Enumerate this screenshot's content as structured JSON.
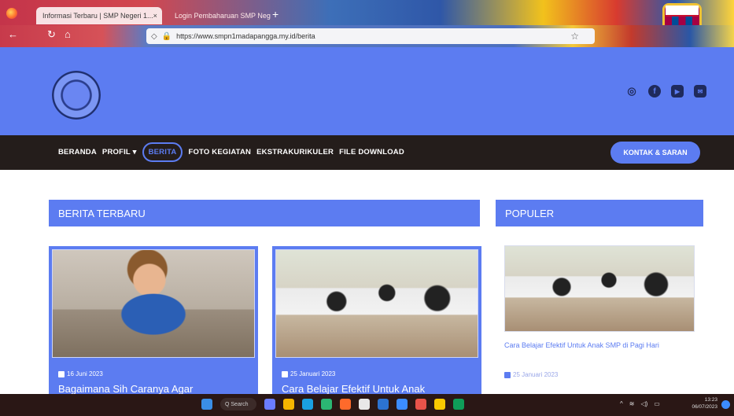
{
  "browser": {
    "tabs": [
      {
        "label": "Informasi Terbaru | SMP Negeri 1...",
        "active": true
      },
      {
        "label": "Login Pembaharuan SMP Negeri...",
        "active": false
      }
    ],
    "url": "https://www.smpn1madapangga.my.id/berita",
    "new_tab_symbol": "+"
  },
  "site": {
    "nav": {
      "items": [
        "BERANDA",
        "PROFIL ▾",
        "BERITA",
        "FOTO KEGIATAN",
        "EKSTRAKURIKULER",
        "FILE DOWNLOAD"
      ],
      "active_index": 2,
      "contact_button": "KONTAK & SARAN"
    },
    "socials": [
      "instagram-icon",
      "facebook-icon",
      "youtube-icon",
      "email-icon"
    ]
  },
  "main": {
    "berita_heading": "BERITA TERBARU",
    "cards": [
      {
        "date": "16 Juni 2023",
        "title": "Bagaimana Sih Caranya Agar"
      },
      {
        "date": "25 Januari 2023",
        "title": "Cara Belajar Efektif Untuk Anak"
      }
    ]
  },
  "sidebar": {
    "populer_heading": "POPULER",
    "post": {
      "title": "Cara Belajar Efektif Untuk Anak SMP di Pagi Hari",
      "date": "25 Januari 2023"
    }
  },
  "taskbar": {
    "search_label": "Q Search",
    "time": "13:23",
    "date": "06/07/2023"
  },
  "colors": {
    "accent": "#5c7cf1",
    "nav_bg": "#241d1b"
  }
}
